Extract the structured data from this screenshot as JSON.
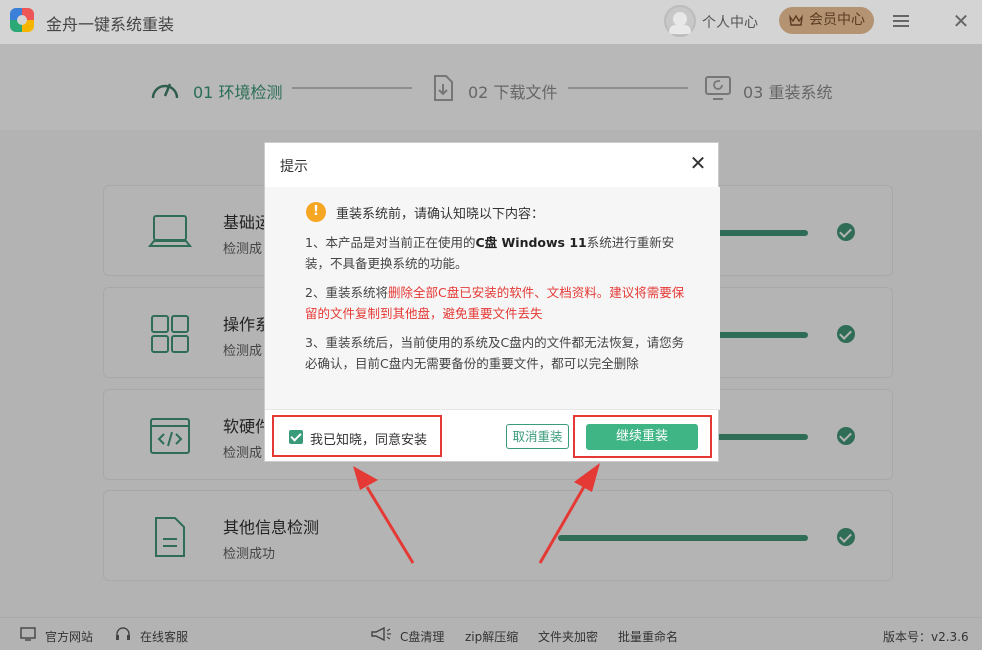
{
  "app": {
    "title": "金舟一键系统重装",
    "personal_center": "个人中心",
    "member_center": "会员中心"
  },
  "steps": [
    {
      "label": "01 环境检测",
      "state": "active"
    },
    {
      "label": "02 下载文件",
      "state": "pending"
    },
    {
      "label": "03 重装系统",
      "state": "pending"
    }
  ],
  "checks": [
    {
      "title": "基础运",
      "status": "检测成",
      "icon": "laptop-icon",
      "progress": 1.0
    },
    {
      "title": "操作系",
      "status": "检测成",
      "icon": "grid-icon",
      "progress": 1.0
    },
    {
      "title": "软硬件",
      "status": "检测成",
      "icon": "code-window-icon",
      "progress": 1.0
    },
    {
      "title": "其他信息检测",
      "status": "检测成功",
      "icon": "document-icon",
      "progress": 1.0
    }
  ],
  "dialog": {
    "title": "提示",
    "warning": "重装系统前，请确认知晓以下内容：",
    "item1_a": "1、本产品是对当前正在使用的",
    "item1_b": "C盘 Windows 11",
    "item1_c": "系统进行重新安装，不具备更换系统的功能。",
    "item2_a": "2、重装系统将",
    "item2_b": "删除全部C盘已安装的软件、文档资料。建议将需要保留的文件复制到其他盘，避免重要文件丢失",
    "item3": "3、重装系统后，当前使用的系统及C盘内的文件都无法恢复，请您务必确认，目前C盘内无需要备份的重要文件，都可以完全删除",
    "agree_label": "我已知晓，同意安装",
    "agree_checked": true,
    "cancel_label": "取消重装",
    "continue_label": "继续重装"
  },
  "footer": {
    "website": "官方网站",
    "support": "在线客服",
    "c_clean": "C盘清理",
    "zip": "zip解压缩",
    "folder_encrypt": "文件夹加密",
    "batch_rename": "批量重命名",
    "version": "版本号：v2.3.6"
  },
  "colors": {
    "accent": "#3fb585",
    "progress": "#2f6d57",
    "highlight": "#e53935",
    "member": "#b49373"
  }
}
